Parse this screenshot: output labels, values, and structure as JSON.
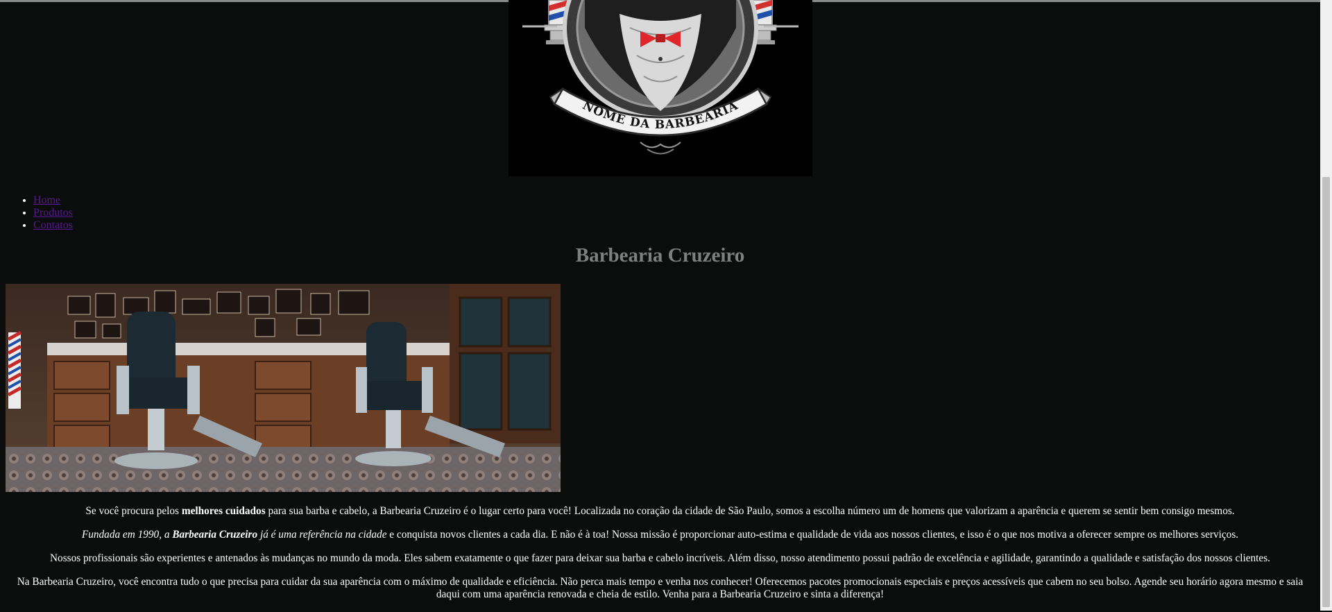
{
  "logo": {
    "text": "NOME DA BARBEARIA",
    "colors": {
      "background": "#000000",
      "bowtie": "#e0262a",
      "pole_red": "#d32f2f",
      "pole_blue": "#1f4fa8"
    }
  },
  "nav": {
    "items": [
      {
        "label": "Home"
      },
      {
        "label": "Produtos"
      },
      {
        "label": "Contatos"
      }
    ],
    "link_color": "#551a8b"
  },
  "page": {
    "title": "Barbearia Cruzeiro",
    "background": "#0b0d0d",
    "title_color": "#7f7f7f"
  },
  "hero": {
    "alt_icon": "barbershop-photo"
  },
  "content": {
    "p1": {
      "a": "Se você procura pelos ",
      "b": "melhores cuidados",
      "c": " para sua barba e cabelo, a Barbearia Cruzeiro é o lugar certo para você! Localizada no coração da cidade de São Paulo, somos a escolha número um de homens que valorizam a aparência e querem se sentir bem consigo mesmos."
    },
    "p2": {
      "a": "Fundada em 1990, a ",
      "b": "Barbearia Cruzeiro",
      "c": " já é uma referência na cidade",
      "d": " e conquista novos clientes a cada dia. E não é à toa! Nossa missão é proporcionar auto-estima e qualidade de vida aos nossos clientes, e isso é o que nos motiva a oferecer sempre os melhores serviços."
    },
    "p3": "Nossos profissionais são experientes e antenados às mudanças no mundo da moda. Eles sabem exatamente o que fazer para deixar sua barba e cabelo incríveis. Além disso, nosso atendimento possui padrão de excelência e agilidade, garantindo a qualidade e satisfação dos nossos clientes.",
    "p4": "Na Barbearia Cruzeiro, você encontra tudo o que precisa para cuidar da sua aparência com o máximo de qualidade e eficiência. Não perca mais tempo e venha nos conhecer! Oferecemos pacotes promocionais especiais e preços acessíveis que cabem no seu bolso. Agende seu horário agora mesmo e saia daqui com uma aparência renovada e cheia de estilo. Venha para a Barbearia Cruzeiro e sinta a diferença!"
  }
}
